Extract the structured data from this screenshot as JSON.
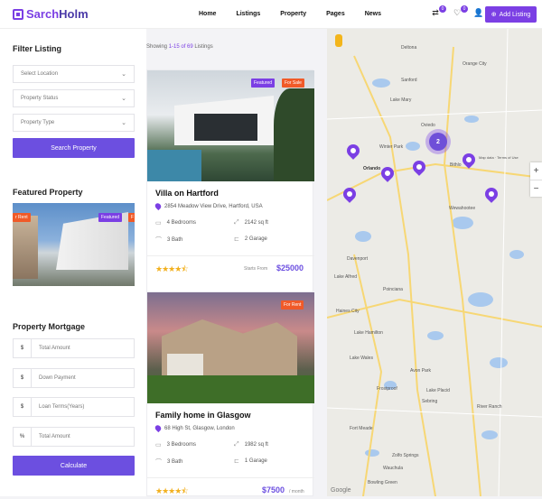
{
  "header": {
    "logo_part1": "Sarch",
    "logo_part2": "Holm",
    "nav": [
      "Home",
      "Listings",
      "Property",
      "Pages",
      "News"
    ],
    "cart_count": "0",
    "fav_count": "0",
    "add_listing": "Add Listing"
  },
  "filter": {
    "title": "Filter Listing",
    "location": "Select Location",
    "status": "Property Status",
    "type": "Property Type",
    "search_button": "Search Property"
  },
  "featured": {
    "title": "Featured Property",
    "tag_featured": "Featured",
    "tag_rent": "For Rent",
    "tag_rent_partial": "r Rent",
    "tag_featured_partial": "F"
  },
  "mortgage": {
    "title": "Property Mortgage",
    "fields": [
      {
        "prefix": "$",
        "placeholder": "Total Amount"
      },
      {
        "prefix": "$",
        "placeholder": "Down Payment"
      },
      {
        "prefix": "$",
        "placeholder": "Loan Terms(Years)"
      },
      {
        "prefix": "%",
        "placeholder": "Total Amount"
      }
    ],
    "calculate": "Calculate"
  },
  "results": {
    "showing": "Showing",
    "range": "1-15 of 69",
    "suffix": "Listings"
  },
  "listings": [
    {
      "title": "Villa on Hartford",
      "address": "2854 Meadow View Drive, Hartford, USA",
      "bedrooms": "4 Bedrooms",
      "area": "2142 sq ft",
      "bath": "3 Bath",
      "garage": "2 Garage",
      "tags": [
        "Featured",
        "For Sale"
      ],
      "rating": 4.5,
      "price_prefix": "Starts From",
      "price": "$25000",
      "price_suffix": ""
    },
    {
      "title": "Family home in Glasgow",
      "address": "68 High St, Glasgow, London",
      "bedrooms": "3 Bedrooms",
      "area": "1982 sq ft",
      "bath": "3 Bath",
      "garage": "1 Garage",
      "tags": [
        "For Rent"
      ],
      "rating": 4.5,
      "price_prefix": "",
      "price": "$7500",
      "price_suffix": "/ month"
    }
  ],
  "map": {
    "cluster_count": "2",
    "labels": [
      "Deltona",
      "Sanford",
      "Orange City",
      "Lake Mary",
      "Oviedo",
      "Winter Park",
      "Orlando",
      "Bithlo",
      "Wewahootee",
      "Davenport",
      "Poinciana",
      "Lake Wales",
      "Frostproof",
      "Lake Placid",
      "Avon Park",
      "Sebring",
      "River Ranch",
      "Lake Hamilton",
      "Fort Meade",
      "Zolfo Springs",
      "Wauchula",
      "Bowling Green",
      "Haines City",
      "Lake Alfred"
    ],
    "attribution": "Map data · Terms of Use",
    "zoom_in": "+",
    "zoom_out": "−",
    "google": "Google"
  },
  "colors": {
    "accent": "#7b3fe4",
    "button": "#6c4fe0",
    "sale": "#f05a28",
    "stars": "#f2b01e"
  }
}
